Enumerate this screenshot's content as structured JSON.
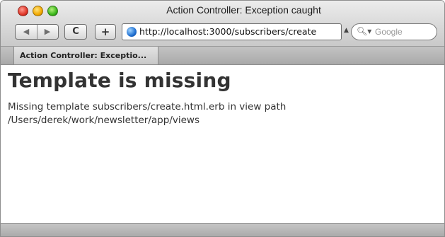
{
  "window": {
    "title": "Action Controller: Exception caught"
  },
  "toolbar": {
    "back_icon": "back-arrow-icon",
    "forward_icon": "forward-arrow-icon",
    "reload_label": "C",
    "add_bookmark_label": "+",
    "url": "http://localhost:3000/subscribers/create",
    "search_placeholder": "Google"
  },
  "tabs": [
    {
      "label": "Action Controller: Exceptio..."
    }
  ],
  "page": {
    "heading": "Template is missing",
    "message": "Missing template subscribers/create.html.erb in view path /Users/derek/work/newsletter/app/views"
  },
  "colors": {
    "close_button": "#e0382a",
    "minimize_button": "#f2a900",
    "zoom_button": "#3cb81c",
    "heading_text": "#333333"
  }
}
